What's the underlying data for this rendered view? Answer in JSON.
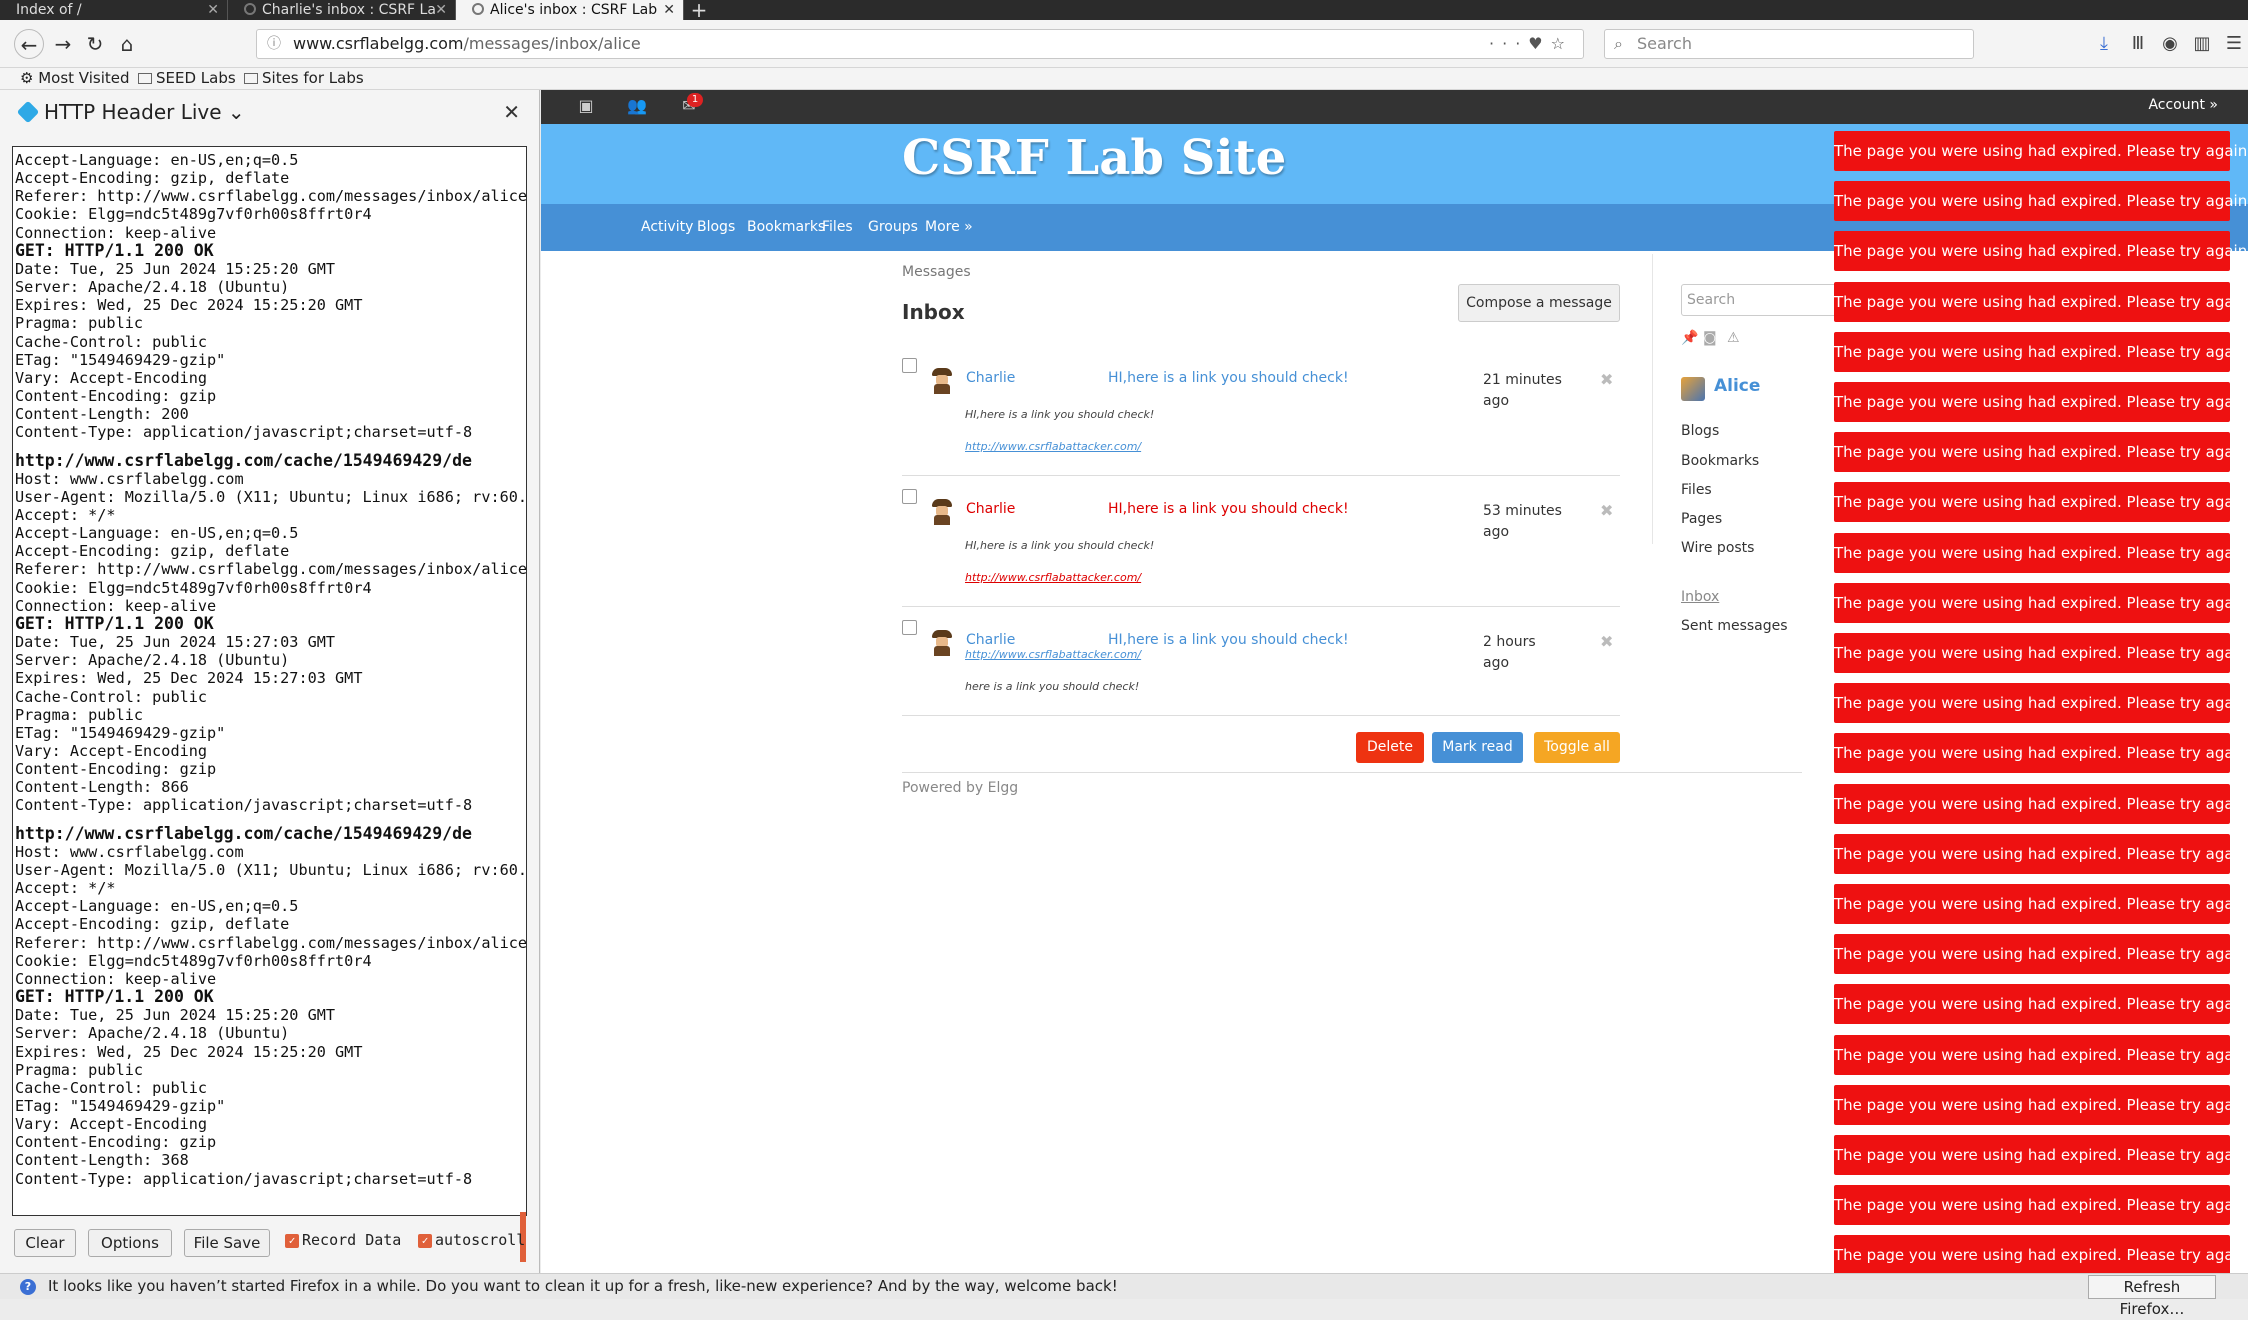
{
  "browser": {
    "tabs": [
      {
        "label": "Index of /",
        "active": false
      },
      {
        "label": "Charlie's inbox : CSRF La",
        "active": false
      },
      {
        "label": "Alice's inbox : CSRF Lab",
        "active": true
      }
    ],
    "url_host": "www.csrflabelgg.com",
    "url_path": "/messages/inbox/alice",
    "search_placeholder": "Search",
    "bookmarks": [
      "Most Visited",
      "SEED Labs",
      "Sites for Labs"
    ]
  },
  "sidebar": {
    "title": "HTTP Header Live",
    "log": [
      {
        "t": "Accept-Language: en-US,en;q=0.5"
      },
      {
        "t": "Accept-Encoding: gzip, deflate"
      },
      {
        "t": "Referer: http://www.csrflabelgg.com/messages/inbox/alice"
      },
      {
        "t": "Cookie: Elgg=ndc5t489g7vf0rh00s8ffrt0r4"
      },
      {
        "t": "Connection: keep-alive"
      },
      {
        "t": "GET: HTTP/1.1 200 OK",
        "s": "strong"
      },
      {
        "t": "Date: Tue, 25 Jun 2024 15:25:20 GMT"
      },
      {
        "t": "Server: Apache/2.4.18 (Ubuntu)"
      },
      {
        "t": "Expires: Wed, 25 Dec 2024 15:25:20 GMT"
      },
      {
        "t": "Pragma: public"
      },
      {
        "t": "Cache-Control: public"
      },
      {
        "t": "ETag: \"1549469429-gzip\""
      },
      {
        "t": "Vary: Accept-Encoding"
      },
      {
        "t": "Content-Encoding: gzip"
      },
      {
        "t": "Content-Length: 200"
      },
      {
        "t": "Content-Type: application/javascript;charset=utf-8"
      },
      {
        "t": "",
        "s": "gap"
      },
      {
        "t": "http://www.csrflabelgg.com/cache/1549469429/de",
        "s": "url"
      },
      {
        "t": "Host: www.csrflabelgg.com"
      },
      {
        "t": "User-Agent: Mozilla/5.0 (X11; Ubuntu; Linux i686; rv:60."
      },
      {
        "t": "Accept: */*"
      },
      {
        "t": "Accept-Language: en-US,en;q=0.5"
      },
      {
        "t": "Accept-Encoding: gzip, deflate"
      },
      {
        "t": "Referer: http://www.csrflabelgg.com/messages/inbox/alice"
      },
      {
        "t": "Cookie: Elgg=ndc5t489g7vf0rh00s8ffrt0r4"
      },
      {
        "t": "Connection: keep-alive"
      },
      {
        "t": "GET: HTTP/1.1 200 OK",
        "s": "strong"
      },
      {
        "t": "Date: Tue, 25 Jun 2024 15:27:03 GMT"
      },
      {
        "t": "Server: Apache/2.4.18 (Ubuntu)"
      },
      {
        "t": "Expires: Wed, 25 Dec 2024 15:27:03 GMT"
      },
      {
        "t": "Cache-Control: public"
      },
      {
        "t": "Pragma: public"
      },
      {
        "t": "ETag: \"1549469429-gzip\""
      },
      {
        "t": "Vary: Accept-Encoding"
      },
      {
        "t": "Content-Encoding: gzip"
      },
      {
        "t": "Content-Length: 866"
      },
      {
        "t": "Content-Type: application/javascript;charset=utf-8"
      },
      {
        "t": "",
        "s": "gap"
      },
      {
        "t": "http://www.csrflabelgg.com/cache/1549469429/de",
        "s": "url"
      },
      {
        "t": "Host: www.csrflabelgg.com"
      },
      {
        "t": "User-Agent: Mozilla/5.0 (X11; Ubuntu; Linux i686; rv:60."
      },
      {
        "t": "Accept: */*"
      },
      {
        "t": "Accept-Language: en-US,en;q=0.5"
      },
      {
        "t": "Accept-Encoding: gzip, deflate"
      },
      {
        "t": "Referer: http://www.csrflabelgg.com/messages/inbox/alice"
      },
      {
        "t": "Cookie: Elgg=ndc5t489g7vf0rh00s8ffrt0r4"
      },
      {
        "t": "Connection: keep-alive"
      },
      {
        "t": "GET: HTTP/1.1 200 OK",
        "s": "strong"
      },
      {
        "t": "Date: Tue, 25 Jun 2024 15:25:20 GMT"
      },
      {
        "t": "Server: Apache/2.4.18 (Ubuntu)"
      },
      {
        "t": "Expires: Wed, 25 Dec 2024 15:25:20 GMT"
      },
      {
        "t": "Pragma: public"
      },
      {
        "t": "Cache-Control: public"
      },
      {
        "t": "ETag: \"1549469429-gzip\""
      },
      {
        "t": "Vary: Accept-Encoding"
      },
      {
        "t": "Content-Encoding: gzip"
      },
      {
        "t": "Content-Length: 368"
      },
      {
        "t": "Content-Type: application/javascript;charset=utf-8"
      }
    ],
    "buttons": {
      "clear": "Clear",
      "options": "Options",
      "file_save": "File Save"
    },
    "checkboxes": {
      "record_data": "Record Data",
      "autoscroll": "autoscroll"
    }
  },
  "site": {
    "topbar": {
      "badge": "1",
      "account": "Account »"
    },
    "title": "CSRF Lab Site",
    "menu": [
      "Activity",
      "Blogs",
      "Bookmarks",
      "Files",
      "Groups",
      "More »"
    ],
    "breadcrumb": "Messages",
    "inbox_title": "Inbox",
    "compose": "Compose a message",
    "messages": [
      {
        "from": "Charlie",
        "subject": "HI,here is a link you should check!",
        "time": "21 minutes ago",
        "body": "HI,here is a link you should check!",
        "link": "http://www.csrflabattacker.com/",
        "unread": false
      },
      {
        "from": "Charlie",
        "subject": "HI,here is a link you should check!",
        "time": "53 minutes ago",
        "body": "HI,here is a link you should check!",
        "link": "http://www.csrflabattacker.com/",
        "unread": true
      },
      {
        "from": "Charlie",
        "subject": "HI,here is a link you should check!",
        "time": "2 hours ago",
        "body": "here is a link you should check!",
        "link": "http://www.csrflabattacker.com/",
        "unread": false
      }
    ],
    "actions": {
      "delete": "Delete",
      "mark_read": "Mark read",
      "toggle_all": "Toggle all"
    },
    "powered_by": "Powered by Elgg",
    "side": {
      "search_placeholder": "Search",
      "user": "Alice",
      "links": [
        "Blogs",
        "Bookmarks",
        "Files",
        "Pages",
        "Wire posts"
      ],
      "inbox": "Inbox",
      "sent": "Sent messages"
    },
    "error_text": "The page you were using had expired. Please try again.",
    "error_count": 23
  },
  "colors": {
    "banner": "#60b8f7",
    "menubar": "#4690d6",
    "error": "#ee1111",
    "delete": "#ee3311",
    "mark_read": "#4690d6",
    "toggle_all": "#f5a623"
  },
  "notification": {
    "text": "It looks like you haven’t started Firefox in a while. Do you want to clean it up for a fresh, like-new experience? And by the way, welcome back!",
    "button": "Refresh Firefox…"
  }
}
